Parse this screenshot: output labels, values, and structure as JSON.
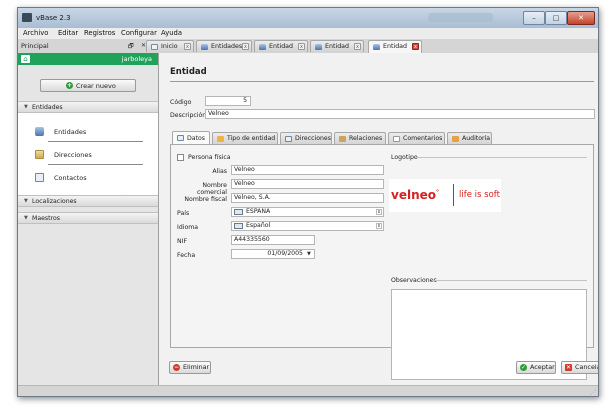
{
  "window": {
    "title": "vBase 2.3",
    "controls": [
      "–",
      "□",
      "✕"
    ]
  },
  "menubar": [
    "Archivo",
    "Editar",
    "Registros",
    "Configurar",
    "Ayuda"
  ],
  "left_panel": {
    "title": "Principal",
    "controls": [
      "🗗",
      "✕"
    ],
    "user": "jarboleya",
    "create_button": "Crear nuevo",
    "sections": [
      "Entidades",
      "Localizaciones",
      "Maestros"
    ],
    "items": [
      "Entidades",
      "Direcciones",
      "Contactos"
    ]
  },
  "tabs": [
    "Inicio",
    "Entidades",
    "Entidad",
    "Entidad",
    "Entidad"
  ],
  "main": {
    "title": "Entidad",
    "codigo_label": "Código",
    "codigo_value": "5",
    "descripcion_label": "Descripción",
    "descripcion_value": "Velneo"
  },
  "form_tabs": [
    "Datos",
    "Tipo de entidad",
    "Direcciones",
    "Relaciones",
    "Comentarios",
    "Auditoría"
  ],
  "datos": {
    "persona_fisica": "Persona física",
    "alias_label": "Alias",
    "alias_value": "Velneo",
    "nombre_comercial_label": "Nombre comercial",
    "nombre_comercial_value": "Velneo",
    "nombre_fiscal_label": "Nombre fiscal",
    "nombre_fiscal_value": "Velneo, S.A.",
    "pais_label": "País",
    "pais_value": "ESPAÑA",
    "idioma_label": "Idioma",
    "idioma_value": "Español",
    "nif_label": "NIF",
    "nif_value": "A44335560",
    "fecha_label": "Fecha",
    "fecha_value": "01/09/2005",
    "logotipo_label": "Logotipo",
    "observaciones_label": "Observaciones"
  },
  "logo": {
    "brand": "velneo",
    "mark": "°",
    "tagline": "life is soft"
  },
  "buttons": {
    "eliminar": "Eliminar",
    "aceptar": "Aceptar",
    "cancelar": "Cancelar"
  },
  "colors": {
    "accent_green": "#1fa25a",
    "logo_red": "#d8201f",
    "window_frame": "#a9bdd3"
  }
}
